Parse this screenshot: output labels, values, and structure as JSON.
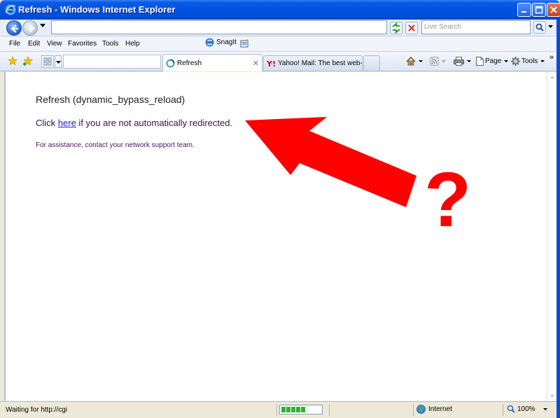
{
  "window": {
    "title": "Refresh - Windows Internet Explorer"
  },
  "address_bar": {
    "url": "",
    "search_placeholder": "Live Search"
  },
  "menu": {
    "items": [
      "File",
      "Edit",
      "View",
      "Favorites",
      "Tools",
      "Help"
    ],
    "snagit_label": "SnagIt"
  },
  "tabs": [
    {
      "label": "Refresh",
      "active": true
    },
    {
      "label": "Yahoo! Mail: The best web-b...",
      "active": false
    }
  ],
  "command_bar": {
    "page_label": "Page",
    "tools_label": "Tools",
    "more": "»"
  },
  "content": {
    "title": "Refresh (dynamic_bypass_reload)",
    "click_prefix": "Click ",
    "click_link": "here",
    "click_suffix": " if you are not automatically redirected.",
    "help_text": "For assistance, contact your network support team.",
    "annotation_mark": "?"
  },
  "status_bar": {
    "text": "Waiting for http://cgi",
    "progress_blocks": 5,
    "zone": "Internet",
    "zoom": "100%"
  },
  "colors": {
    "annotation": "#ff0000",
    "link": "#1f1ad6",
    "titlebar": "#0054e3"
  }
}
